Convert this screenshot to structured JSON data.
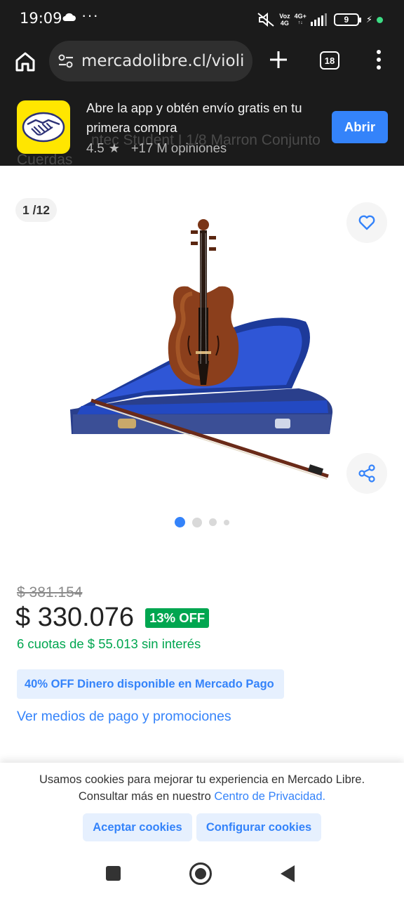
{
  "status_bar": {
    "time": "19:09",
    "network_top": "Voz",
    "network_bottom": "4G",
    "network_gen": "4G+",
    "battery_level": "9"
  },
  "browser": {
    "url": "mercadolibre.cl/violin-",
    "tab_count": "18"
  },
  "app_banner": {
    "text": "Abre la app y obtén envío gratis en tu primera compra",
    "rating": "4.5",
    "reviews": "+17 M opiniones",
    "open_label": "Abrir",
    "underlying_title": "ntec Student I 1/8 Marron Conjunto",
    "underlying_title_2": "Cuerdas"
  },
  "gallery": {
    "counter": "1 /12",
    "active_index": 0,
    "dots": 4
  },
  "price": {
    "original": "$ 381.154",
    "current": "$ 330.076",
    "discount": "13% OFF",
    "installments": "6 cuotas de $ 55.013 sin interés",
    "promo": "40% OFF Dinero disponible en Mercado Pago",
    "payment_link": "Ver medios de pago y promociones"
  },
  "cookies": {
    "line1": "Usamos cookies para mejorar tu experiencia en Mercado Libre.",
    "line2_prefix": "Consultar más en nuestro",
    "line2_link": "Centro de Privacidad.",
    "accept_label": "Aceptar cookies",
    "configure_label": "Configurar cookies"
  },
  "colors": {
    "brand_yellow": "#ffe600",
    "accent_blue": "#3483fa",
    "success_green": "#00a650",
    "chrome_dark": "#1b1b1b"
  },
  "icons": [
    "cloud-icon",
    "mute-icon",
    "home-icon",
    "tune-icon",
    "plus-icon",
    "tabs-icon",
    "more-icon",
    "heart-icon",
    "share-icon",
    "star-icon"
  ]
}
